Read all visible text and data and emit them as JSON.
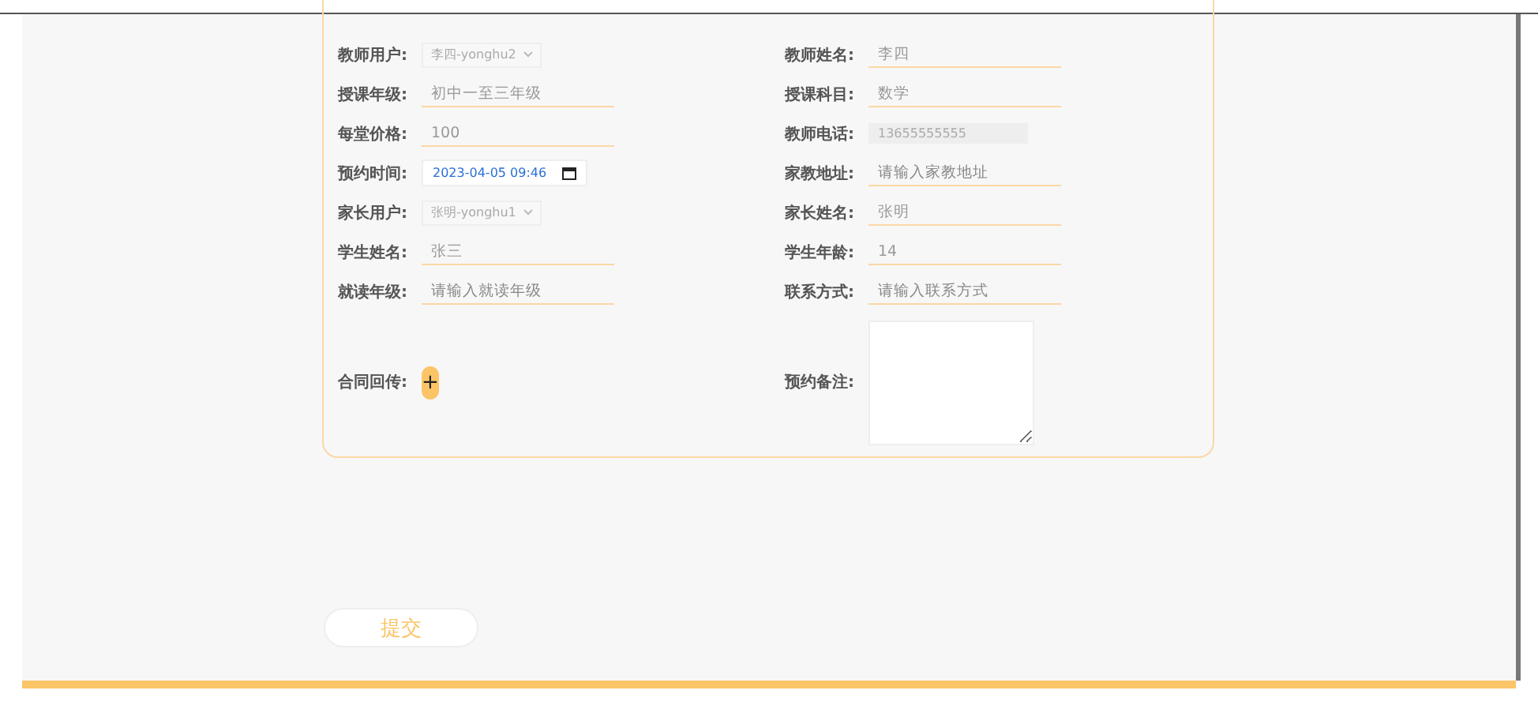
{
  "form": {
    "rows": [
      {
        "left": {
          "label": "教师用户:",
          "kind": "select",
          "value": "李四-yonghu2"
        },
        "right": {
          "label": "教师姓名:",
          "kind": "text",
          "value": "李四"
        }
      },
      {
        "left": {
          "label": "授课年级:",
          "kind": "text",
          "value": "初中一至三年级"
        },
        "right": {
          "label": "授课科目:",
          "kind": "text",
          "value": "数学"
        }
      },
      {
        "left": {
          "label": "每堂价格:",
          "kind": "text",
          "value": "100"
        },
        "right": {
          "label": "教师电话:",
          "kind": "readonly",
          "value": "13655555555"
        }
      },
      {
        "left": {
          "label": "预约时间:",
          "kind": "datetime",
          "value": "2023-04-05 09:46"
        },
        "right": {
          "label": "家教地址:",
          "kind": "text",
          "placeholder": "请输入家教地址"
        }
      },
      {
        "left": {
          "label": "家长用户:",
          "kind": "select",
          "value": "张明-yonghu1"
        },
        "right": {
          "label": "家长姓名:",
          "kind": "text",
          "value": "张明"
        }
      },
      {
        "left": {
          "label": "学生姓名:",
          "kind": "text",
          "value": "张三"
        },
        "right": {
          "label": "学生年龄:",
          "kind": "text",
          "value": "14"
        }
      },
      {
        "left": {
          "label": "就读年级:",
          "kind": "text",
          "placeholder": "请输入就读年级"
        },
        "right": {
          "label": "联系方式:",
          "kind": "text",
          "placeholder": "请输入联系方式"
        }
      },
      {
        "left": {
          "label": "合同回传:",
          "kind": "upload",
          "value": "+"
        },
        "right": {
          "label": "预约备注:",
          "kind": "textarea"
        }
      }
    ]
  },
  "submit": "提交"
}
